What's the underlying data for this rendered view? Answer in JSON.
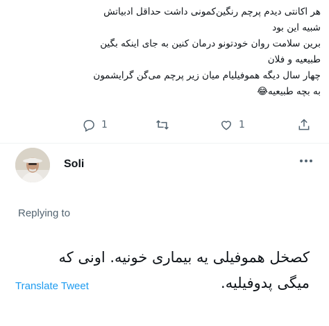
{
  "previous_tweet": {
    "lines": [
      "هر اکانتی دیدم پرچم رنگین‌کمونی داشت حداقل ادبیاتش",
      "شبیه این بود",
      "برین سلامت روان خودتونو درمان کنین به جای اینکه بگین",
      "طبیعیه و فلان",
      "چهار سال دیگه هموفیلیام میان زیر پرچم می‌گن گرایشمون",
      "به بچه طبیعیه😂"
    ],
    "actions": {
      "reply_count": "1",
      "like_count": "1"
    },
    "icons": [
      "reply-icon",
      "retweet-icon",
      "like-icon",
      "share-icon"
    ]
  },
  "reply": {
    "author": "Soli",
    "replying_to_label": "Replying to",
    "text_lines": [
      "کصخل هموفیلی یه بیماری خونیه.  اونی که",
      "میگی پدوفیلیه."
    ],
    "translate_label": "Translate Tweet"
  },
  "colors": {
    "text": "#0f1419",
    "muted": "#536471",
    "link": "#1d9bf0",
    "divider": "#eff3f4"
  }
}
